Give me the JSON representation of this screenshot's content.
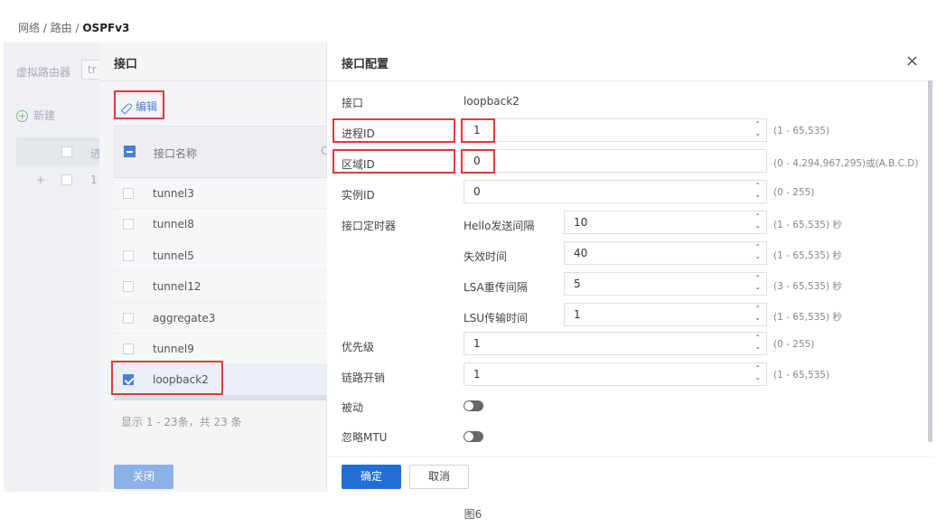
{
  "breadcrumb": {
    "path": "网络 / 路由 / ",
    "current": "OSPFv3"
  },
  "background": {
    "vrouter_label": "虚拟路由器",
    "vrouter_value": "tr",
    "new_label": "新建",
    "col_initial": "进",
    "row_expand": "+",
    "row_value": "1"
  },
  "mid": {
    "title": "接口",
    "edit_label": "编辑",
    "col_name": "接口名称",
    "col_c": "C",
    "rows": [
      "tunnel3",
      "tunnel8",
      "tunnel5",
      "tunnel12",
      "aggregate3",
      "tunnel9",
      "loopback2"
    ],
    "footer": "显示 1 - 23条，共 23 条",
    "close_label": "关闭"
  },
  "cfg": {
    "title": "接口配置",
    "close_icon": "×",
    "interface_label": "接口",
    "interface_value": "loopback2",
    "process_label": "进程ID",
    "process_value": "1",
    "process_hint": "(1 - 65,535)",
    "area_label": "区域ID",
    "area_value": "0",
    "area_hint": "(0 - 4,294,967,295)或(A.B.C.D)",
    "instance_label": "实例ID",
    "instance_value": "0",
    "instance_hint": "(0 - 255)",
    "timer_label": "接口定时器",
    "hello_label": "Hello发送间隔",
    "hello_value": "10",
    "hello_hint": "(1 - 65,535) 秒",
    "dead_label": "失效时间",
    "dead_value": "40",
    "dead_hint": "(1 - 65,535) 秒",
    "lsa_label": "LSA重传间隔",
    "lsa_value": "5",
    "lsa_hint": "(3 - 65,535) 秒",
    "lsu_label": "LSU传输时间",
    "lsu_value": "1",
    "lsu_hint": "(1 - 65,535) 秒",
    "priority_label": "优先级",
    "priority_value": "1",
    "priority_hint": "(0 - 255)",
    "cost_label": "链路开销",
    "cost_value": "1",
    "cost_hint": "(1 - 65,535)",
    "passive_label": "被动",
    "ignore_mtu_label": "忽略MTU",
    "ok_label": "确定",
    "cancel_label": "取消"
  },
  "caption": "图6",
  "colors": {
    "accent": "#1f6fd6",
    "highlight": "#e0393e"
  }
}
